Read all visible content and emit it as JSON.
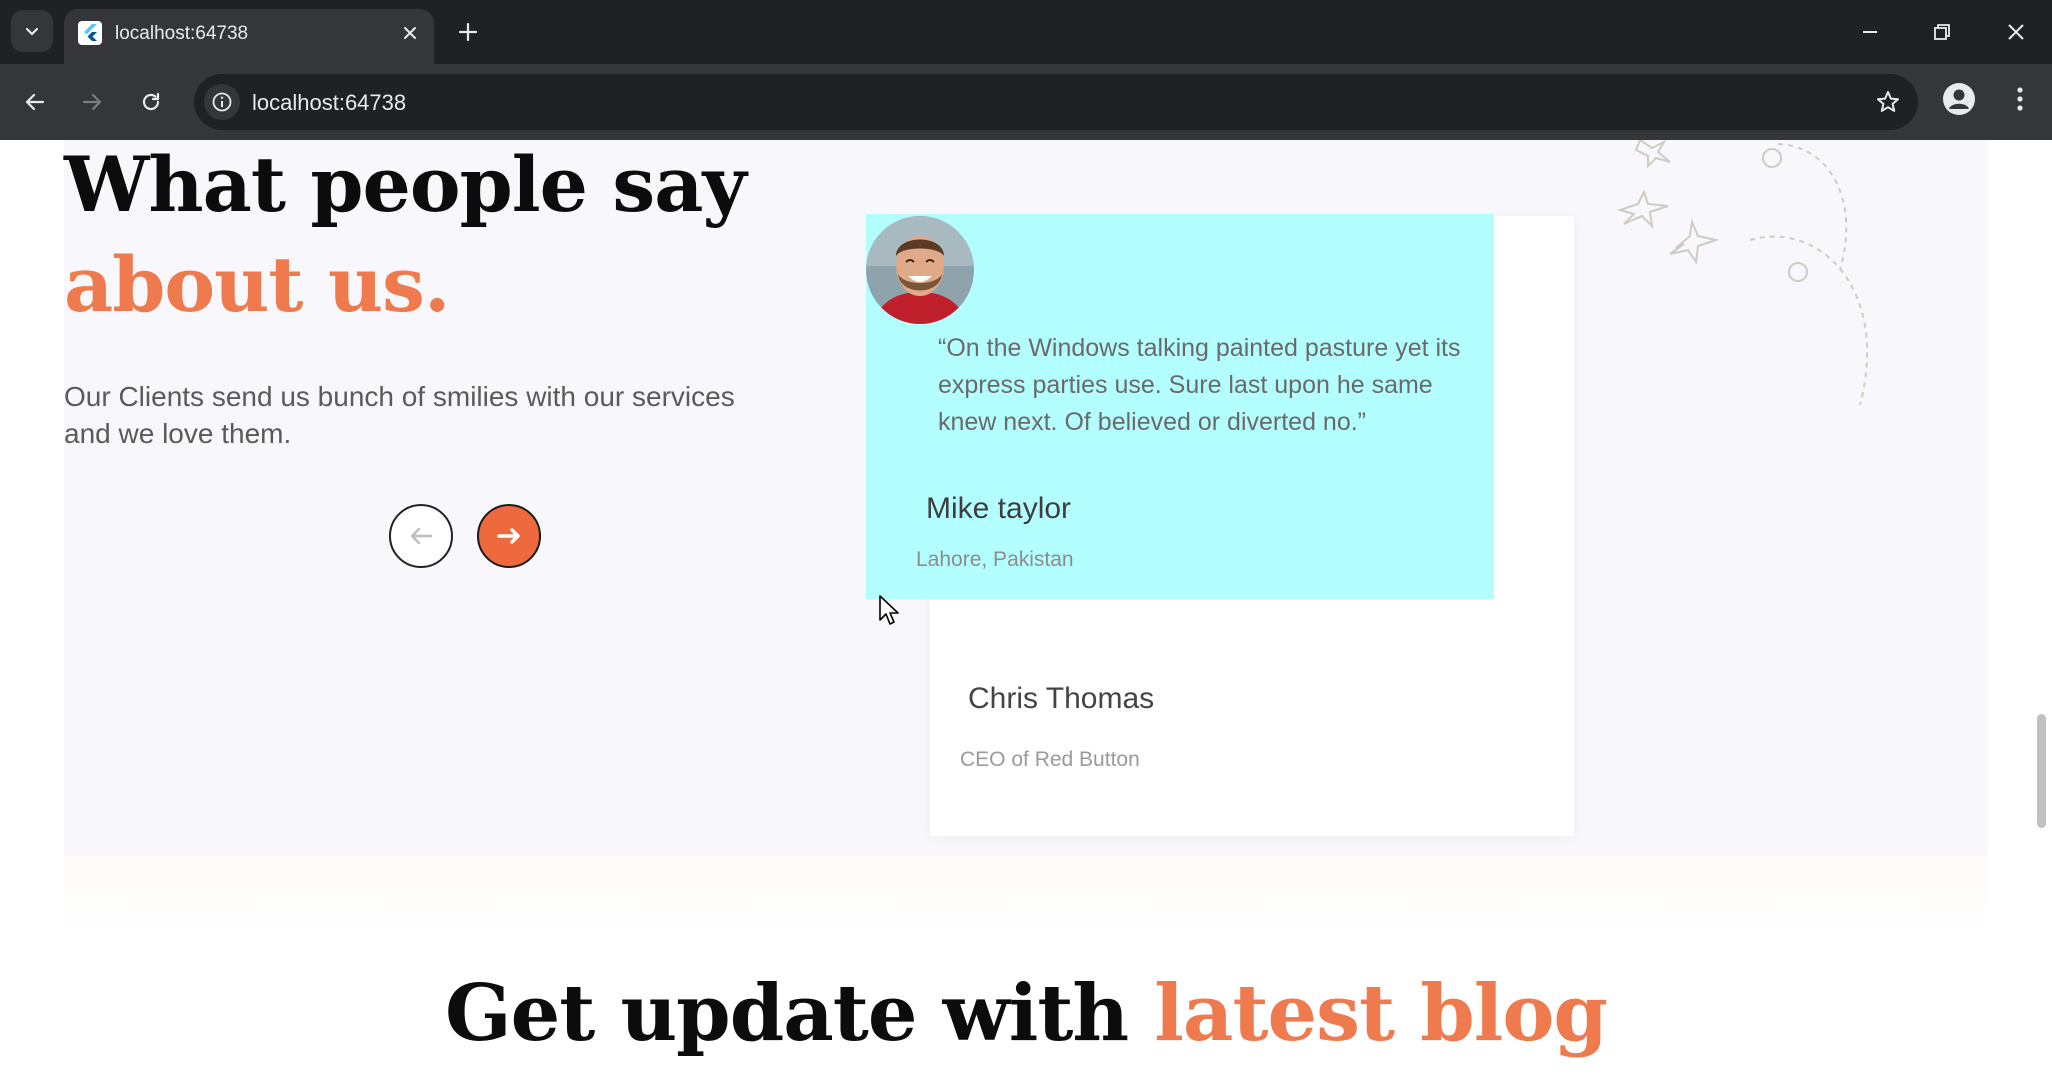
{
  "browser": {
    "tab_title": "localhost:64738",
    "url": "localhost:64738",
    "icons": {
      "tab_search": "chevron-down-icon",
      "close_tab": "close-icon",
      "new_tab": "plus-icon",
      "back": "arrow-left-icon",
      "forward": "arrow-right-icon",
      "reload": "reload-icon",
      "site_info": "info-icon",
      "bookmark": "star-icon",
      "profile": "profile-icon",
      "menu": "kebab-menu-icon"
    }
  },
  "testimonials": {
    "title_line1": "What people say",
    "title_line2": "about us.",
    "subtitle": "Our Clients send us bunch of smilies with our services\n and we love them.",
    "prev_icon": "arrow-left-icon",
    "next_icon": "arrow-right-icon",
    "active_card": {
      "quote": "“On the Windows talking painted pasture yet its express parties use. Sure last upon he same knew next. Of believed or diverted no.”",
      "name": "Mike taylor",
      "location": "Lahore, Pakistan",
      "background_color": "#b3ffff"
    },
    "back_card": {
      "name": "Chris Thomas",
      "role": "CEO of Red Button"
    }
  },
  "blog": {
    "heading_plain": "Get update with",
    "heading_accent": "latest blog"
  },
  "colors": {
    "accent": "#ee7a4d",
    "button": "#ee6a3e",
    "chrome_dark": "#202124",
    "chrome_mid": "#35363a"
  }
}
